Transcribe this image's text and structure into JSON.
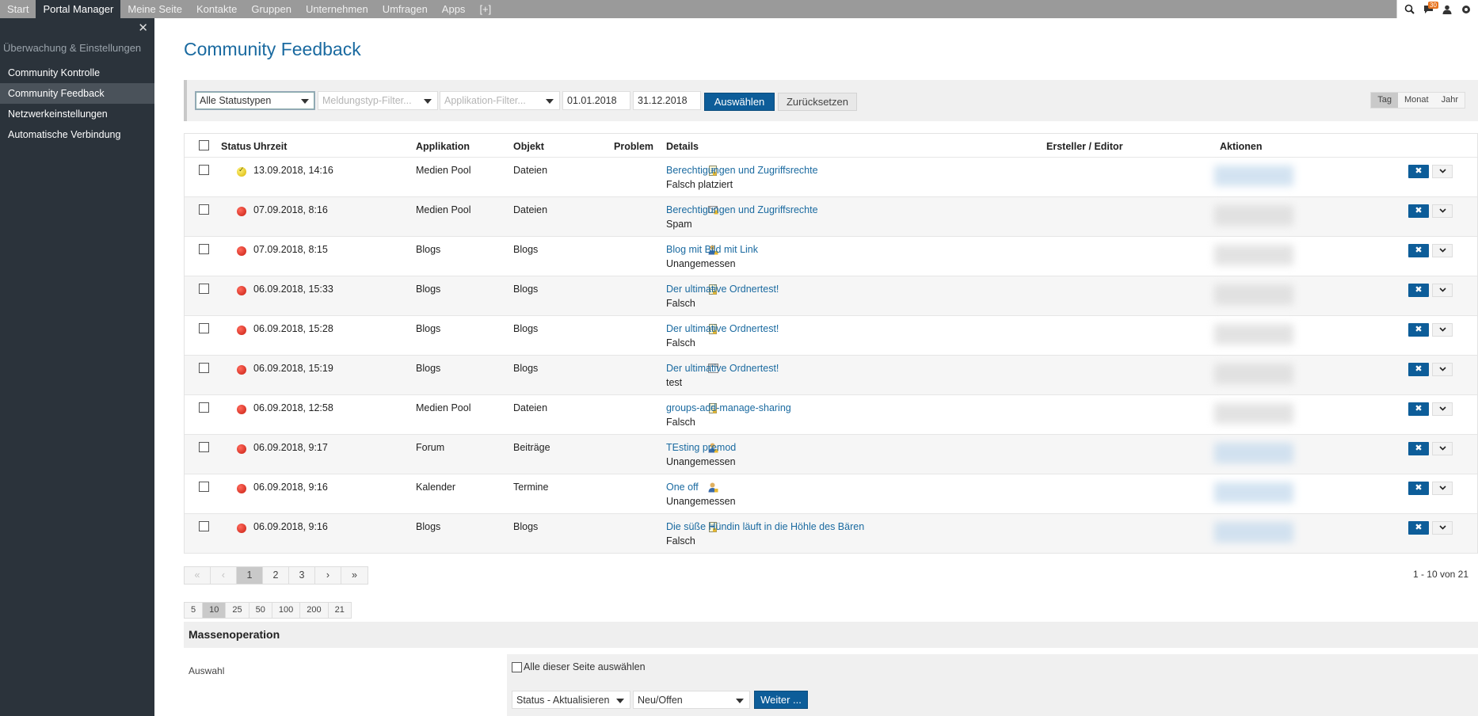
{
  "topnav": {
    "items": [
      "Start",
      "Portal Manager",
      "Meine Seite",
      "Kontakte",
      "Gruppen",
      "Unternehmen",
      "Umfragen",
      "Apps",
      "[+]"
    ],
    "active_index": 1,
    "notification_count": "30"
  },
  "sidebar": {
    "section": "Überwachung & Einstellungen",
    "items": [
      "Community Kontrolle",
      "Community Feedback",
      "Netzwerkeinstellungen",
      "Automatische Verbindung"
    ],
    "active_index": 1
  },
  "page": {
    "title": "Community Feedback"
  },
  "filters": {
    "status": "Alle Statustypen",
    "type_placeholder": "Meldungstyp-Filter...",
    "app_placeholder": "Applikation-Filter...",
    "date_from": "01.01.2018",
    "date_to": "31.12.2018",
    "select_label": "Auswählen",
    "reset_label": "Zurücksetzen",
    "granularity": [
      "Tag",
      "Monat",
      "Jahr"
    ],
    "granularity_active": 0
  },
  "table": {
    "headers": {
      "status": "Status",
      "time": "Uhrzeit",
      "app": "Applikation",
      "object": "Objekt",
      "problem": "Problem",
      "details": "Details",
      "author": "Ersteller / Editor",
      "actions": "Aktionen"
    },
    "rows": [
      {
        "status": "ok",
        "time": "13.09.2018, 14:16",
        "app": "Medien Pool",
        "object": "Dateien",
        "problem_icon": "document-icon",
        "title": "Berechtigungen und Zugriffsrechte",
        "reason": "Falsch platziert",
        "author_blur": "blue"
      },
      {
        "status": "open",
        "time": "07.09.2018, 8:16",
        "app": "Medien Pool",
        "object": "Dateien",
        "problem_icon": "mail-icon",
        "title": "Berechtigungen und Zugriffsrechte",
        "reason": "Spam",
        "author_blur": "gray"
      },
      {
        "status": "open",
        "time": "07.09.2018, 8:15",
        "app": "Blogs",
        "object": "Blogs",
        "problem_icon": "user-icon",
        "title": "Blog mit Bild mit Link",
        "reason": "Unangemessen",
        "author_blur": "gray"
      },
      {
        "status": "open",
        "time": "06.09.2018, 15:33",
        "app": "Blogs",
        "object": "Blogs",
        "problem_icon": "document-icon",
        "title": "Der ultimative Ordnertest!",
        "reason": "Falsch",
        "author_blur": "gray"
      },
      {
        "status": "open",
        "time": "06.09.2018, 15:28",
        "app": "Blogs",
        "object": "Blogs",
        "problem_icon": "document-icon",
        "title": "Der ultimative Ordnertest!",
        "reason": "Falsch",
        "author_blur": "gray"
      },
      {
        "status": "open",
        "time": "06.09.2018, 15:19",
        "app": "Blogs",
        "object": "Blogs",
        "problem_icon": "window-icon",
        "title": "Der ultimative Ordnertest!",
        "reason": "test",
        "author_blur": "gray"
      },
      {
        "status": "open",
        "time": "06.09.2018, 12:58",
        "app": "Medien Pool",
        "object": "Dateien",
        "problem_icon": "document-icon",
        "title": "groups-add-manage-sharing",
        "reason": "Falsch",
        "author_blur": "gray"
      },
      {
        "status": "open",
        "time": "06.09.2018, 9:17",
        "app": "Forum",
        "object": "Beiträge",
        "problem_icon": "user-icon",
        "title": "TEsting premod",
        "reason": "Unangemessen",
        "author_blur": "blue"
      },
      {
        "status": "open",
        "time": "06.09.2018, 9:16",
        "app": "Kalender",
        "object": "Termine",
        "problem_icon": "user-icon",
        "title": "One off",
        "reason": "Unangemessen",
        "author_blur": "blue"
      },
      {
        "status": "open",
        "time": "06.09.2018, 9:16",
        "app": "Blogs",
        "object": "Blogs",
        "problem_icon": "document-icon",
        "title": "Die süße Hündin läuft in die Höhle des Bären",
        "reason": "Falsch",
        "author_blur": "blue"
      }
    ]
  },
  "pagination": {
    "items": [
      "«",
      "‹",
      "1",
      "2",
      "3",
      "›",
      "»"
    ],
    "active": "1",
    "disabled": [
      "«",
      "‹"
    ],
    "range_text": "1 - 10 von 21",
    "sizes": [
      "5",
      "10",
      "25",
      "50",
      "100",
      "200",
      "21"
    ],
    "size_active": "10"
  },
  "mass": {
    "title": "Massenoperation",
    "selection_label": "Auswahl",
    "select_all_label": "Alle dieser Seite auswählen",
    "operation": "Status - Aktualisieren",
    "value": "Neu/Offen",
    "next_label": "Weiter ..."
  }
}
